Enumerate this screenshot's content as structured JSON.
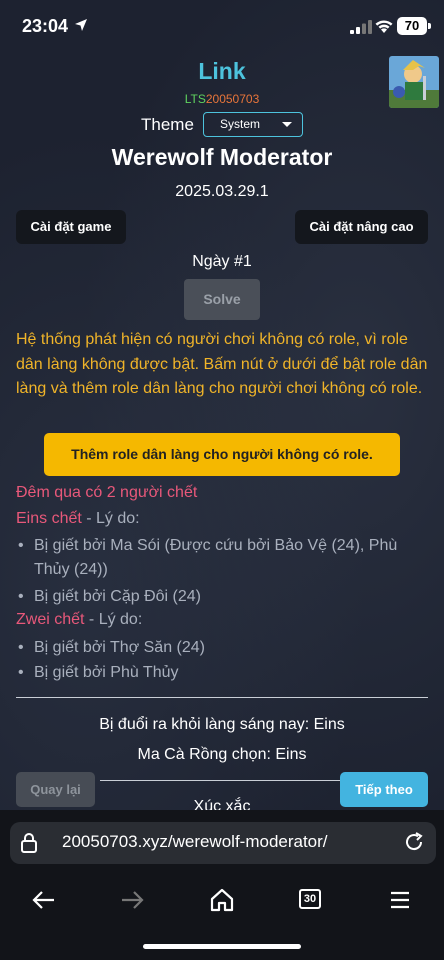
{
  "status_bar": {
    "time": "23:04",
    "battery": "70"
  },
  "header": {
    "link": "Link",
    "lts_prefix": "LTS",
    "lts_number": "20050703",
    "theme_label": "Theme",
    "theme_value": "System",
    "title": "Werewolf Moderator",
    "version": "2025.03.29.1"
  },
  "buttons": {
    "game_settings": "Cài đặt game",
    "advanced_settings": "Cài đặt nâng cao",
    "solve": "Solve",
    "add_villager_role": "Thêm role dân làng cho người không có role.",
    "back": "Quay lại",
    "next": "Tiếp theo"
  },
  "day_label": "Ngày #1",
  "warning": "Hệ thống phát hiện có người chơi không có role, vì role dân làng không được bật. Bấm nút ở dưới để bật role dân làng và thêm role dân làng cho người chơi không có role.",
  "night_report": {
    "summary": "Đêm qua có 2 người chết",
    "deaths": [
      {
        "name": "Eins chết",
        "reason_label": " - Lý do:",
        "reasons": [
          "Bị giết bởi Ma Sói (Được cứu bởi Bảo Vệ (24), Phù Thủy (24))",
          "Bị giết bởi Cặp Đôi (24)"
        ]
      },
      {
        "name": "Zwei chết",
        "reason_label": " - Lý do:",
        "reasons": [
          "Bị giết bởi Thợ Săn (24)",
          "Bị giết bởi Phù Thủy"
        ]
      }
    ]
  },
  "exiled": "Bị đuổi ra khỏi làng sáng nay: Eins",
  "vampire": "Ma Cà Rồng chọn: Eins",
  "dice": "Xúc xắc",
  "browser": {
    "url": "20050703.xyz/werewolf-moderator/",
    "tabs_count": "30"
  }
}
